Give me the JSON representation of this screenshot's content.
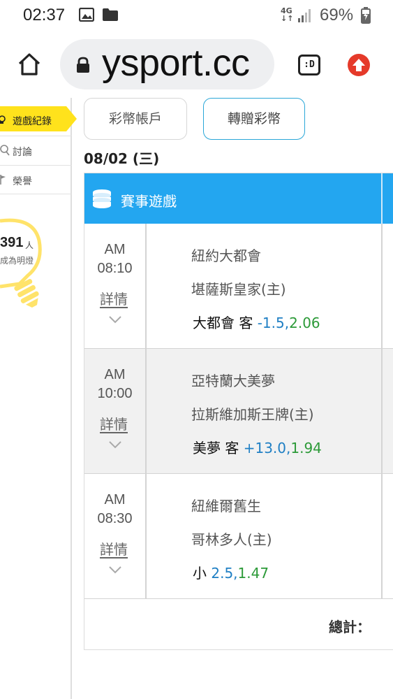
{
  "status_bar": {
    "time": "02:37",
    "network": "4G",
    "battery": "69%"
  },
  "browser": {
    "url": "ysport.cc",
    "tab_label": ":D"
  },
  "sidebar": {
    "active_item": "遊戲紀錄",
    "items": [
      {
        "label": "討論",
        "icon": "search-icon"
      },
      {
        "label": "榮譽",
        "icon": "flag-icon"
      }
    ],
    "count": "391",
    "count_unit": "人",
    "count_sub": "成為明燈"
  },
  "main": {
    "buttons": {
      "account": "彩幣帳戶",
      "transfer": "轉贈彩幣"
    },
    "date": "08/02 (三)",
    "table_title": "賽事遊戲",
    "games": [
      {
        "ampm": "AM",
        "time": "08:10",
        "detail": "詳情",
        "team_away": "紐約大都會",
        "team_home": "堪薩斯皇家(主)",
        "pick_text": "大都會 客",
        "line": "-1.5,",
        "odds": "2.06"
      },
      {
        "ampm": "AM",
        "time": "10:00",
        "detail": "詳情",
        "team_away": "亞特蘭大美夢",
        "team_home": "拉斯維加斯王牌(主)",
        "pick_text": "美夢 客",
        "line": "+13.0,",
        "odds": "1.94"
      },
      {
        "ampm": "AM",
        "time": "08:30",
        "detail": "詳情",
        "team_away": "紐維爾舊生",
        "team_home": "哥林多人(主)",
        "pick_text": "小",
        "line": "2.5,",
        "odds": "1.47"
      }
    ],
    "total_label": "總計："
  },
  "colors": {
    "accent_blue": "#23a6f0",
    "sidebar_active": "#ffe21c",
    "line_blue": "#1f7fc4",
    "odds_green": "#2c9a38",
    "upload_red": "#e53a2a"
  }
}
